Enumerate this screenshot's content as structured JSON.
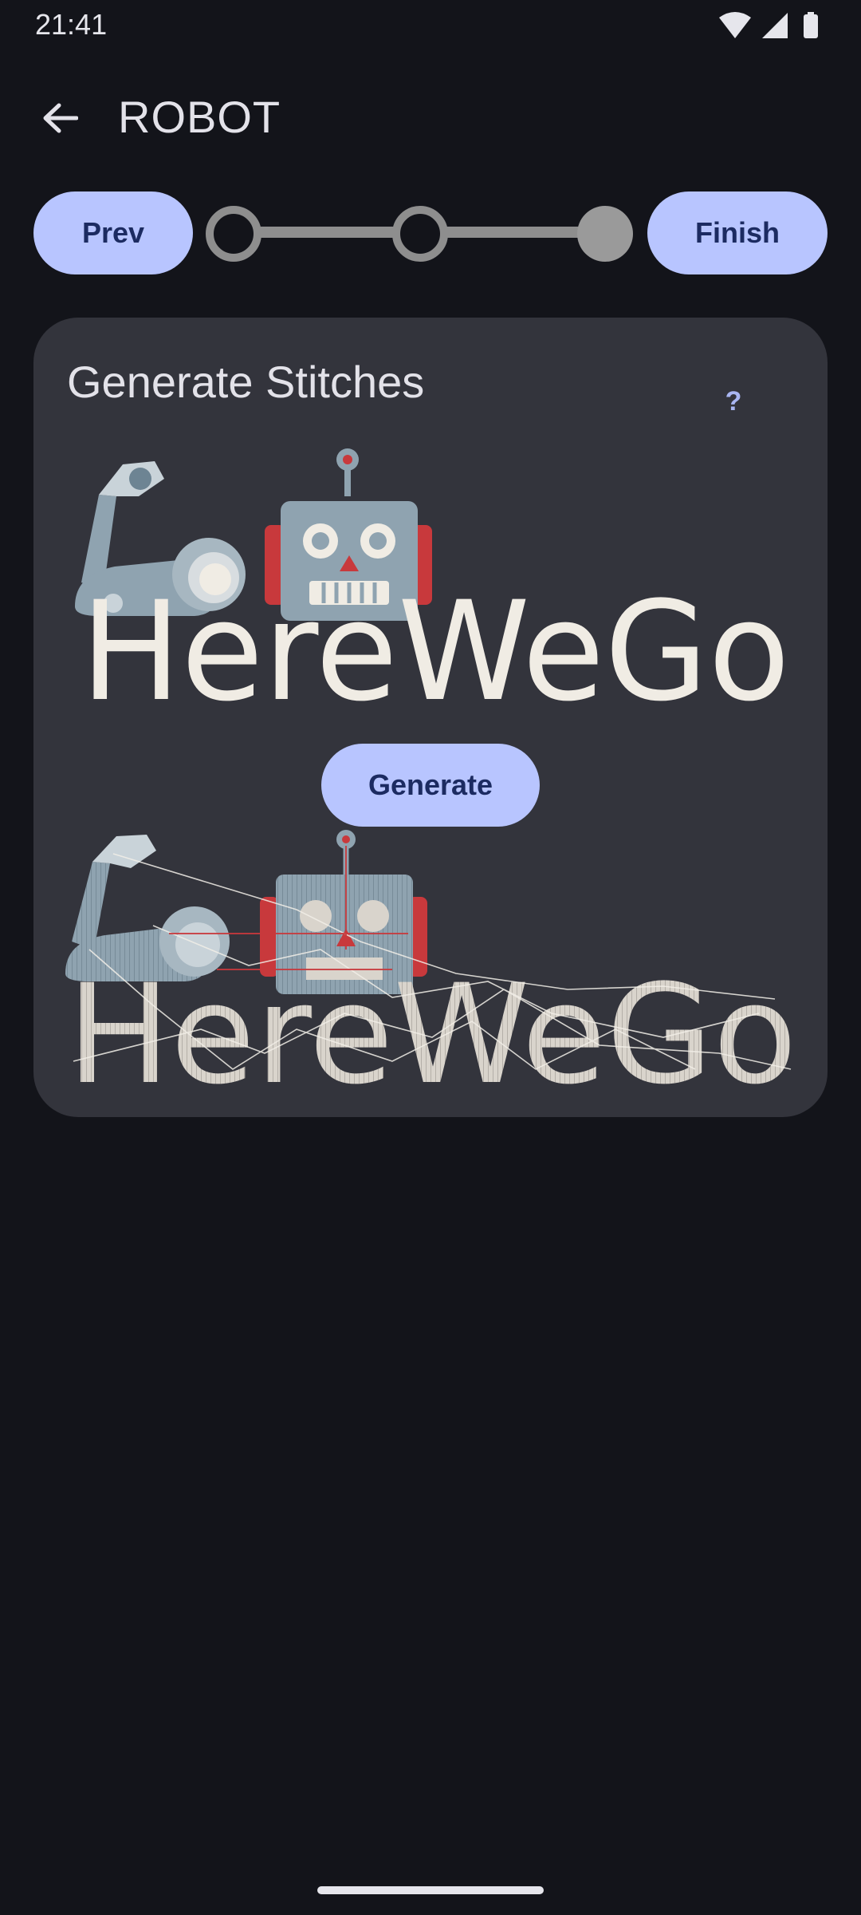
{
  "status_bar": {
    "time": "21:41",
    "icons": [
      "wifi-icon",
      "cell-signal-icon",
      "battery-icon"
    ]
  },
  "app_bar": {
    "title": "ROBOT",
    "back_icon": "arrow-left-icon"
  },
  "stepper": {
    "prev_label": "Prev",
    "finish_label": "Finish",
    "steps": [
      {
        "state": "incomplete"
      },
      {
        "state": "incomplete"
      },
      {
        "state": "current"
      }
    ]
  },
  "card": {
    "title": "Generate Stitches",
    "help_label": "?",
    "generate_label": "Generate",
    "preview_top": {
      "text": "HereWeGo"
    },
    "preview_bottom": {
      "text": "HereWeGo"
    }
  },
  "colors": {
    "background": "#13141a",
    "card": "#33343c",
    "accent_button": "#b8c5ff",
    "button_text": "#1c2b61",
    "robot_body": "#8fa3b0",
    "robot_ears": "#c8393c",
    "text_cream": "#f0ece4"
  }
}
